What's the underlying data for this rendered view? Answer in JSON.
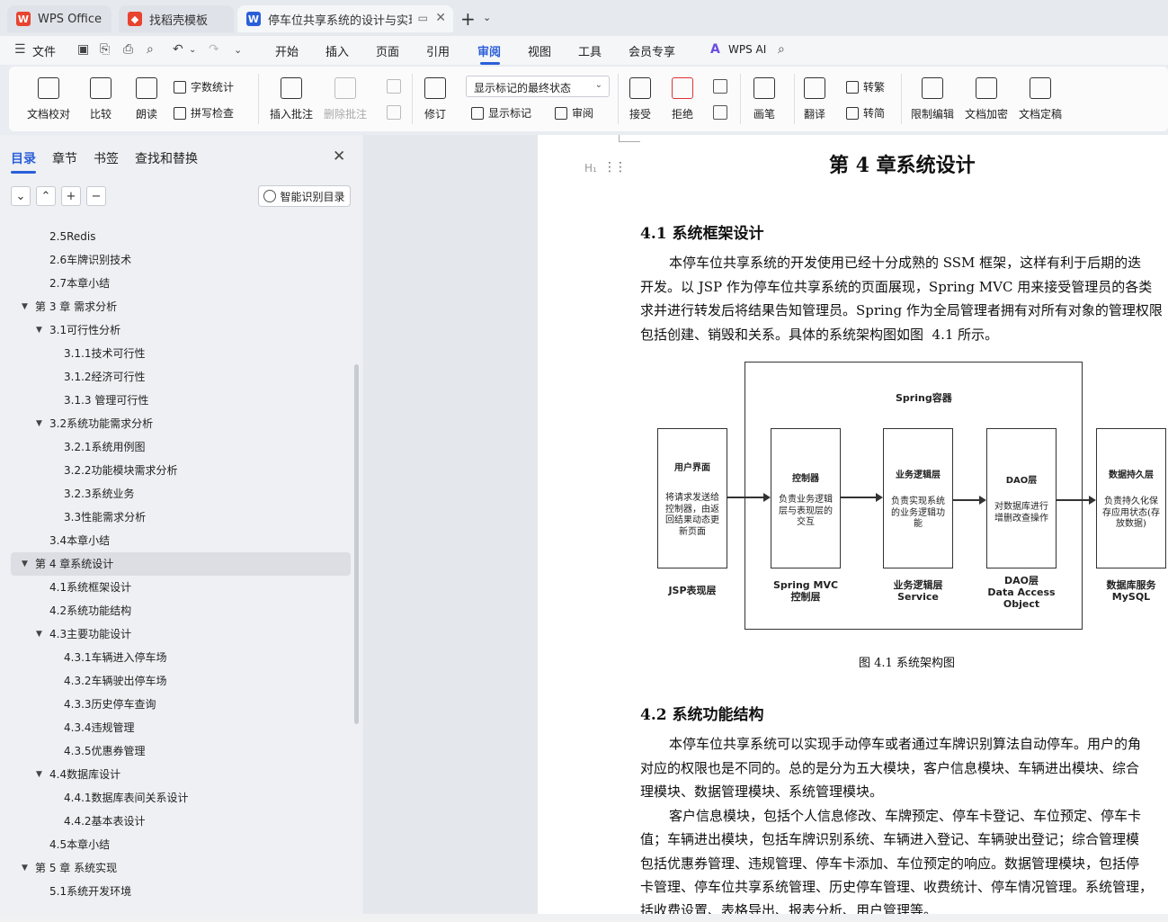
{
  "tabs": [
    {
      "label": "WPS Office",
      "icon": "wps-logo-icon",
      "color": "#e8432f"
    },
    {
      "label": "找稻壳模板",
      "icon": "docer-icon",
      "color": "#e8432f"
    },
    {
      "label": "停车位共享系统的设计与实现",
      "icon": "word-doc-icon",
      "color": "#2b5fd9"
    }
  ],
  "menu": {
    "file": "文件",
    "items": [
      "开始",
      "插入",
      "页面",
      "引用",
      "审阅",
      "视图",
      "工具",
      "会员专享"
    ],
    "active": "审阅",
    "ai": "WPS AI"
  },
  "ribbon": {
    "doc_check": "文档校对",
    "compare": "比较",
    "read_aloud": "朗读",
    "word_count": "字数统计",
    "spell_check": "拼写检查",
    "insert_comment": "插入批注",
    "delete_comment": "删除批注",
    "revise": "修订",
    "markup_state": "显示标记的最终状态",
    "show_markup": "显示标记",
    "review": "审阅",
    "accept": "接受",
    "reject": "拒绝",
    "pen": "画笔",
    "translate": "翻译",
    "to_traditional": "转繁",
    "to_simplified": "转简",
    "restrict_edit": "限制编辑",
    "encrypt": "文档加密",
    "finalize": "文档定稿"
  },
  "sidebar": {
    "tabs": [
      "目录",
      "章节",
      "书签",
      "查找和替换"
    ],
    "smart_toc": "智能识别目录",
    "toc": [
      {
        "label": "2.5Redis",
        "level": 2,
        "caret": false
      },
      {
        "label": "2.6车牌识别技术",
        "level": 2,
        "caret": false
      },
      {
        "label": "2.7本章小结",
        "level": 2,
        "caret": false
      },
      {
        "label": "第 3 章  需求分析",
        "level": 1,
        "caret": true
      },
      {
        "label": "3.1可行性分析",
        "level": 2,
        "caret": true
      },
      {
        "label": "3.1.1技术可行性",
        "level": 3,
        "caret": false
      },
      {
        "label": "3.1.2经济可行性",
        "level": 3,
        "caret": false
      },
      {
        "label": "3.1.3  管理可行性",
        "level": 3,
        "caret": false
      },
      {
        "label": "3.2系统功能需求分析",
        "level": 2,
        "caret": true
      },
      {
        "label": "3.2.1系统用例图",
        "level": 3,
        "caret": false
      },
      {
        "label": "3.2.2功能模块需求分析",
        "level": 3,
        "caret": false
      },
      {
        "label": "3.2.3系统业务",
        "level": 3,
        "caret": false
      },
      {
        "label": "3.3性能需求分析",
        "level": 3,
        "caret": false
      },
      {
        "label": "3.4本章小结",
        "level": 2,
        "caret": false
      },
      {
        "label": "第 4 章系统设计",
        "level": 1,
        "caret": true,
        "selected": true
      },
      {
        "label": "4.1系统框架设计",
        "level": 2,
        "caret": false
      },
      {
        "label": "4.2系统功能结构",
        "level": 2,
        "caret": false
      },
      {
        "label": "4.3主要功能设计",
        "level": 2,
        "caret": true
      },
      {
        "label": "4.3.1车辆进入停车场",
        "level": 3,
        "caret": false
      },
      {
        "label": "4.3.2车辆驶出停车场",
        "level": 3,
        "caret": false
      },
      {
        "label": "4.3.3历史停车查询",
        "level": 3,
        "caret": false
      },
      {
        "label": "4.3.4违规管理",
        "level": 3,
        "caret": false
      },
      {
        "label": "4.3.5优惠券管理",
        "level": 3,
        "caret": false
      },
      {
        "label": "4.4数据库设计",
        "level": 2,
        "caret": true
      },
      {
        "label": "4.4.1数据库表间关系设计",
        "level": 3,
        "caret": false
      },
      {
        "label": "4.4.2基本表设计",
        "level": 3,
        "caret": false
      },
      {
        "label": "4.5本章小结",
        "level": 2,
        "caret": false
      },
      {
        "label": "第 5 章  系统实现",
        "level": 1,
        "caret": true
      },
      {
        "label": "5.1系统开发环境",
        "level": 2,
        "caret": false
      }
    ]
  },
  "doc": {
    "chapter_title": "第 4 章系统设计",
    "s41_title": "4.1  系统框架设计",
    "s41_p1": "本停车位共享系统的开发使用已经十分成熟的 SSM 框架，这样有利于后期的迭",
    "s41_p2": "开发。以 JSP 作为停车位共享系统的页面展现，Spring MVC 用来接受管理员的各类",
    "s41_p3": "求并进行转发后将结果告知管理员。Spring 作为全局管理者拥有对所有对象的管理权限",
    "s41_p4": "包括创建、销毁和关系。具体的系统架构图如图  4.1 所示。",
    "figure_caption": "图  4.1  系统架构图",
    "s42_title": "4.2  系统功能结构",
    "s42_p1": "本停车位共享系统可以实现手动停车或者通过车牌识别算法自动停车。用户的角",
    "s42_p2": "对应的权限也是不同的。总的是分为五大模块，客户信息模块、车辆进出模块、综合",
    "s42_p3": "理模块、数据管理模块、系统管理模块。",
    "s42_p4": "客户信息模块，包括个人信息修改、车牌预定、停车卡登记、车位预定、停车卡",
    "s42_p5": "值；车辆进出模块，包括车牌识别系统、车辆进入登记、车辆驶出登记；综合管理模",
    "s42_p6": "包括优惠券管理、违规管理、停车卡添加、车位预定的响应。数据管理模块，包括停",
    "s42_p7": "卡管理、停车位共享系统管理、历史停车管理、收费统计、停车情况管理。系统管理，",
    "s42_p8": "括收费设置、表格导出、报表分析、用户管理等。"
  },
  "diagram": {
    "container": "Spring容器",
    "boxes": [
      {
        "title": "用户界面",
        "desc": "将请求发送给控制器，由返回结果动态更新页面",
        "label": "JSP表现层"
      },
      {
        "title": "控制器",
        "desc": "负责业务逻辑层与表现层的交互",
        "label": "Spring MVC\n控制层"
      },
      {
        "title": "业务逻辑层",
        "desc": "负责实现系统的业务逻辑功能",
        "label": "业务逻辑层\nService"
      },
      {
        "title": "DAO层",
        "desc": "对数据库进行增删改查操作",
        "label": "DAO层\nData Access\nObject"
      },
      {
        "title": "数据持久层",
        "desc": "负责持久化保存应用状态(存放数据)",
        "label": "数据库服务\nMySQL"
      }
    ]
  }
}
